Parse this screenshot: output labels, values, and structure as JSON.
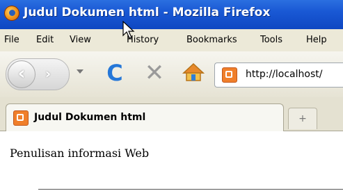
{
  "window": {
    "title": "Judul Dokumen html - Mozilla Firefox",
    "icon": "firefox-icon"
  },
  "menu": {
    "items": [
      {
        "label": "File"
      },
      {
        "label": "Edit"
      },
      {
        "label": "View"
      },
      {
        "label": "History"
      },
      {
        "label": "Bookmarks"
      },
      {
        "label": "Tools"
      },
      {
        "label": "Help"
      }
    ]
  },
  "toolbar": {
    "back_icon": "back-arrow-icon",
    "forward_icon": "forward-arrow-icon",
    "reload_icon": "reload-icon",
    "stop_icon": "stop-icon",
    "home_icon": "home-icon",
    "url": "http://localhost/"
  },
  "tabs": [
    {
      "title": "Judul Dokumen html",
      "active": true
    }
  ],
  "new_tab_symbol": "+",
  "page": {
    "paragraph": "Penulisan informasi Web"
  },
  "colors": {
    "titlebar": "#1958d4",
    "reload": "#2577d8",
    "site_icon": "#f07f2b"
  }
}
